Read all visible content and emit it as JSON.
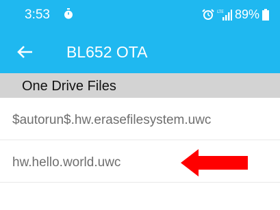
{
  "status_bar": {
    "time": "3:53",
    "battery": "89%",
    "icons": [
      "timer-icon",
      "alarm-icon",
      "signal-icon",
      "battery-icon"
    ]
  },
  "app_bar": {
    "title": "BL652 OTA",
    "back_icon": "back-arrow-icon"
  },
  "section": {
    "header": "One Drive Files"
  },
  "files": [
    {
      "name": "$autorun$.hw.erasefilesystem.uwc"
    },
    {
      "name": "hw.hello.world.uwc"
    }
  ],
  "colors": {
    "accent": "#1fb8f0",
    "section_header_bg": "#d3d3d3",
    "annotation_arrow": "#ff0000",
    "file_text": "#6e6e6e"
  }
}
